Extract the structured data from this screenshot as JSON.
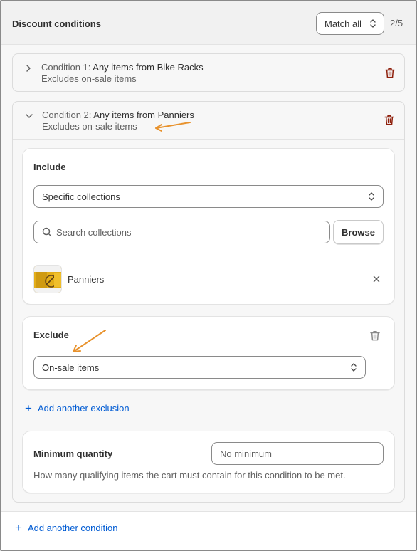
{
  "header": {
    "title": "Discount conditions",
    "match_label": "Match all",
    "page_count": "2/5"
  },
  "conditions": [
    {
      "label": "Condition 1: ",
      "summary": "Any items from Bike Racks",
      "subtext": "Excludes on-sale items",
      "expanded": false
    },
    {
      "label": "Condition 2: ",
      "summary": "Any items from Panniers",
      "subtext": "Excludes on-sale items",
      "expanded": true
    }
  ],
  "include": {
    "title": "Include",
    "select_value": "Specific collections",
    "search_placeholder": "Search collections",
    "browse_label": "Browse",
    "items": [
      {
        "name": "Panniers"
      }
    ]
  },
  "exclude": {
    "title": "Exclude",
    "select_value": "On-sale items"
  },
  "add_exclusion_label": "Add another exclusion",
  "minimum_quantity": {
    "label": "Minimum quantity",
    "placeholder": "No minimum",
    "help": "How many qualifying items the cart must contain for this condition to be met."
  },
  "add_condition_label": "Add another condition",
  "colors": {
    "link": "#005bd3",
    "delete": "#8e1f0b",
    "annotation_arrow": "#e8922d"
  }
}
